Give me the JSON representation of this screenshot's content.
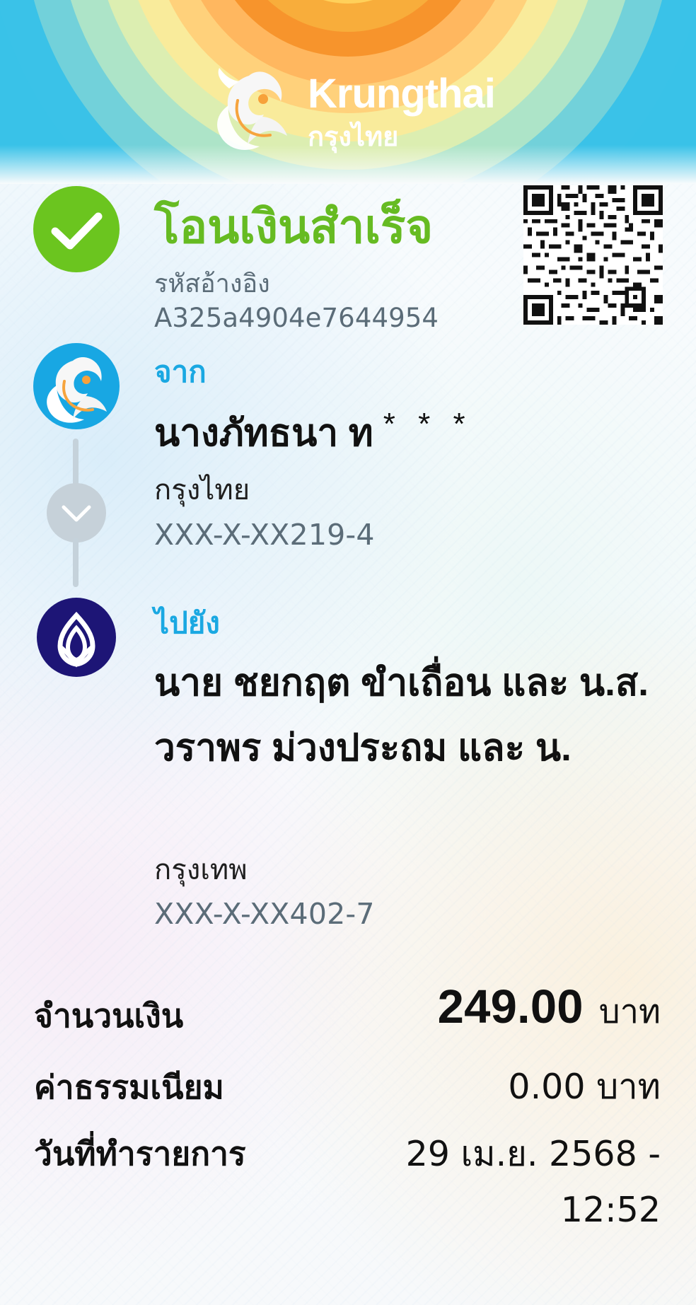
{
  "header": {
    "brand_name_en": "Krungthai",
    "brand_name_th": "กรุงไทย",
    "logo_icon": "krungthai-bird-logo-icon",
    "colors": {
      "blue": "#39c2e8",
      "orange": "#f7941e",
      "yellow": "#f9e58b"
    }
  },
  "status": {
    "title": "โอนเงินสำเร็จ",
    "success_icon": "check-icon",
    "reference_label": "รหัสอ้างอิง",
    "reference_value": "A325a4904e7644954",
    "qr_icon": "qr-code"
  },
  "sender": {
    "label": "จาก",
    "name": "นางภัทธนา ท",
    "masked_suffix": "* * *",
    "bank": "กรุงไทย",
    "account": "XXX-X-XX219-4",
    "icon": "krungthai-bird-icon"
  },
  "transfer": {
    "arrow_icon": "chevron-down-icon"
  },
  "recipient": {
    "label": "ไปยัง",
    "name": "นาย ชยกฤต ขำเถื่อน และ น.ส. วราพร ม่วงประถม และ น.",
    "bank": "กรุงเทพ",
    "account": "XXX-X-XX402-7",
    "icon": "bangkok-bank-lotus-icon"
  },
  "summary": {
    "amount_label": "จำนวนเงิน",
    "amount_value": "249.00",
    "amount_unit": "บาท",
    "fee_label": "ค่าธรรมเนียม",
    "fee_value": "0.00 บาท",
    "date_label": "วันที่ทำรายการ",
    "date_value": "29 เม.ย. 2568 - 12:52"
  }
}
